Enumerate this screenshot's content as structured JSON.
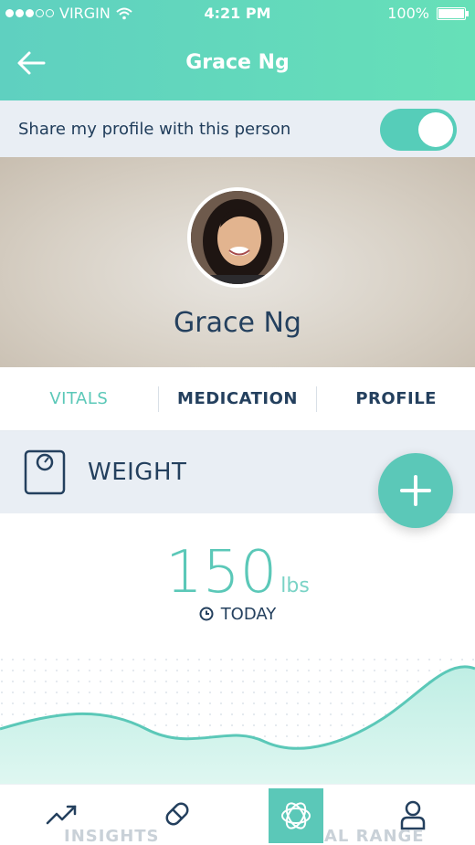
{
  "status_bar": {
    "carrier": "VIRGIN",
    "time": "4:21 PM",
    "battery": "100%"
  },
  "nav": {
    "title": "Grace Ng"
  },
  "share": {
    "label": "Share my profile with this person",
    "enabled": true
  },
  "profile": {
    "name": "Grace Ng"
  },
  "tabs": [
    {
      "label": "VITALS",
      "active": true
    },
    {
      "label": "MEDICATION",
      "active": false
    },
    {
      "label": "PROFILE",
      "active": false
    }
  ],
  "weight": {
    "title": "WEIGHT",
    "value": "150",
    "unit": "lbs",
    "date_label": "TODAY"
  },
  "bottom_nav": {
    "items": [
      "trend-icon",
      "pill-icon",
      "vitals-icon",
      "profile-icon"
    ],
    "active_index": 2,
    "faint_left": "INSIGHTS",
    "faint_right": "AL RANGE"
  },
  "colors": {
    "accent": "#5bc8b8",
    "header": "#5fd0c0",
    "text": "#24405e",
    "panel": "#e9eef4"
  }
}
